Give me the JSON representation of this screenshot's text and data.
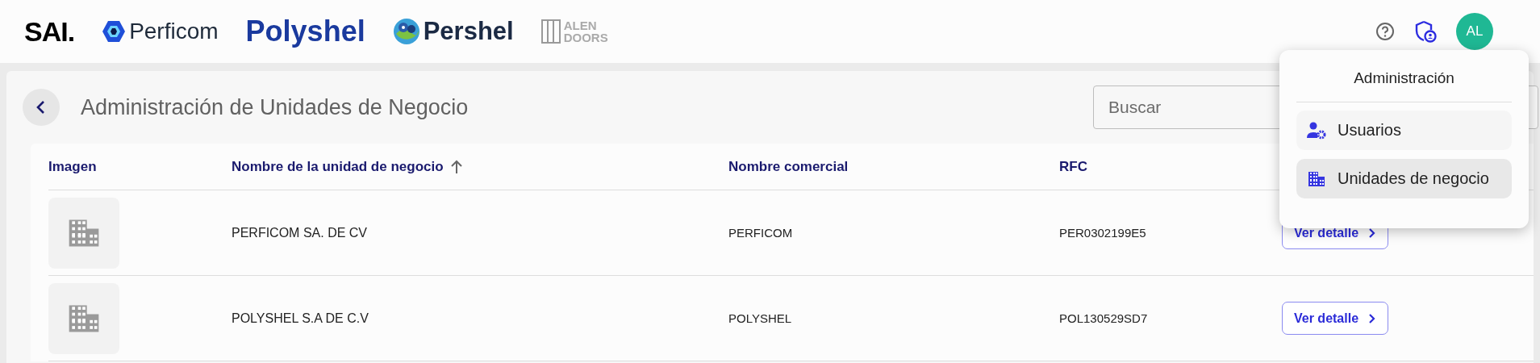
{
  "header": {
    "logos": [
      {
        "kind": "sai",
        "text": "SAI."
      },
      {
        "kind": "perficom",
        "text": "Perficom"
      },
      {
        "kind": "polyshel",
        "text": "Polyshel"
      },
      {
        "kind": "pershel",
        "text": "Pershel"
      },
      {
        "kind": "alen",
        "text": "ALEN DOORS"
      }
    ],
    "avatar": "AL"
  },
  "page": {
    "title": "Administración de Unidades de Negocio",
    "search": {
      "placeholder": "Buscar"
    }
  },
  "table": {
    "columns": [
      {
        "label": "Imagen",
        "sorted": false
      },
      {
        "label": "Nombre de la unidad de negocio",
        "sorted": true
      },
      {
        "label": "Nombre comercial",
        "sorted": false
      },
      {
        "label": "RFC",
        "sorted": false
      }
    ],
    "rows": [
      {
        "name": "PERFICOM SA. DE CV",
        "commercial": "PERFICOM",
        "rfc": "PER0302199E5",
        "action": "Ver detalle"
      },
      {
        "name": "POLYSHEL S.A DE C.V",
        "commercial": "POLYSHEL",
        "rfc": "POL130529SD7",
        "action": "Ver detalle"
      }
    ]
  },
  "menu": {
    "title": "Administración",
    "items": [
      {
        "kind": "users",
        "label": "Usuarios",
        "selected": false
      },
      {
        "kind": "units",
        "label": "Unidades de negocio",
        "selected": true
      }
    ]
  }
}
